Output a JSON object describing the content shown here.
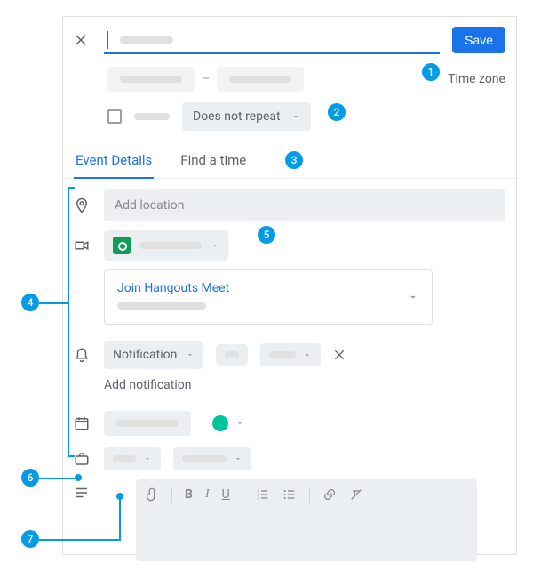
{
  "header": {
    "save_label": "Save",
    "time_zone_label": "Time zone",
    "repeat_label": "Does not repeat"
  },
  "tabs": {
    "details": "Event Details",
    "find_time": "Find a time"
  },
  "fields": {
    "location_placeholder": "Add location",
    "join_meet": "Join Hangouts Meet",
    "notification_label": "Notification",
    "add_notification": "Add notification"
  },
  "callouts": {
    "c1": "1",
    "c2": "2",
    "c3": "3",
    "c4": "4",
    "c5": "5",
    "c6": "6",
    "c7": "7"
  }
}
